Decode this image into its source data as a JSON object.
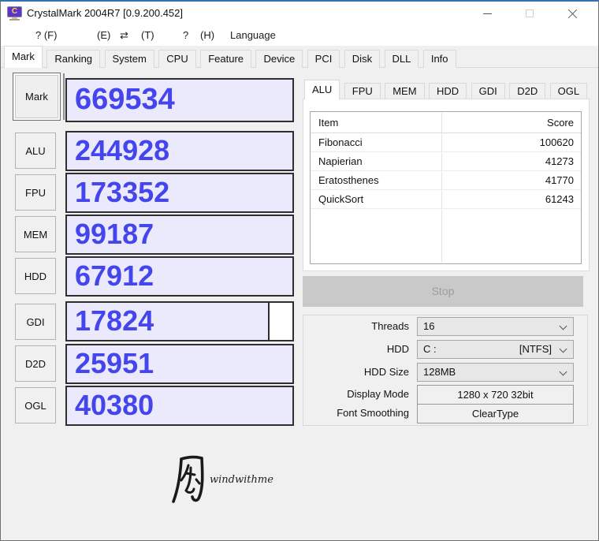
{
  "window": {
    "title": "CrystalMark 2004R7 [0.9.200.452]"
  },
  "menu": {
    "tokens": [
      "? (F)",
      "(E)",
      "⇄",
      "(T)",
      "?",
      "(H)",
      "Language"
    ]
  },
  "tabs": {
    "main": [
      "Mark",
      "Ranking",
      "System",
      "CPU",
      "Feature",
      "Device",
      "PCI",
      "Disk",
      "DLL",
      "Info"
    ],
    "active": "Mark"
  },
  "benchmarks": {
    "items": [
      {
        "label": "Mark",
        "score": "669534"
      },
      {
        "label": "ALU",
        "score": "244928"
      },
      {
        "label": "FPU",
        "score": "173352"
      },
      {
        "label": "MEM",
        "score": "99187"
      },
      {
        "label": "HDD",
        "score": "67912"
      },
      {
        "label": "GDI",
        "score": "17824"
      },
      {
        "label": "D2D",
        "score": "25951"
      },
      {
        "label": "OGL",
        "score": "40380"
      }
    ]
  },
  "detail": {
    "tabs": [
      "ALU",
      "FPU",
      "MEM",
      "HDD",
      "GDI",
      "D2D",
      "OGL"
    ],
    "active_tab": "ALU",
    "table": {
      "headers": [
        "Item",
        "Score"
      ],
      "rows": [
        [
          "Fibonacci",
          "100620"
        ],
        [
          "Napierian",
          "41273"
        ],
        [
          "Eratosthenes",
          "41770"
        ],
        [
          "QuickSort",
          "61243"
        ]
      ]
    }
  },
  "controls": {
    "stop_label": "Stop",
    "threads": {
      "label": "Threads",
      "value": "16"
    },
    "hdd": {
      "label": "HDD",
      "value": "C :",
      "extra": "[NTFS]"
    },
    "hdd_size": {
      "label": "HDD Size",
      "value": "128MB"
    },
    "display_mode": {
      "label": "Display Mode",
      "value": "1280 x 720 32bit"
    },
    "font_smoothing": {
      "label": "Font Smoothing",
      "value": "ClearType"
    }
  },
  "logo": {
    "kanji": "風",
    "text": "windwithme"
  },
  "colors": {
    "score_text": "#4545ee",
    "score_bg": "#eaeafc",
    "titlebar_accent": "#3272b3",
    "stop_bg": "#c9c9c9"
  }
}
